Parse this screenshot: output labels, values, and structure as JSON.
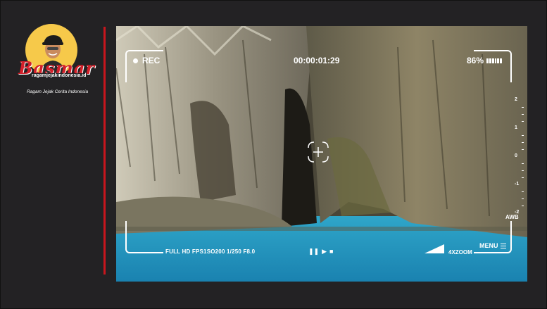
{
  "brand": {
    "logo_script": "Basmar",
    "site": "ragamjejakindonesia.id",
    "tagline": "Ragam Jejak Cerita Indonesia"
  },
  "viewfinder": {
    "rec_label": "REC",
    "timecode": "00:00:01:29",
    "battery_percent": "86%",
    "battery_level": 0.86,
    "exposure_scale": [
      "2",
      "1",
      "0",
      "-1",
      "-2"
    ],
    "awb_label": "AWB",
    "info_line": "FULL HD FPS1SO200 1/250 F8.0",
    "controls": [
      "pause-icon",
      "play-icon",
      "stop-icon"
    ],
    "zoom_label": "4XZOOM",
    "menu_label": "MENU"
  },
  "colors": {
    "background": "#232224",
    "accent_red": "#c8161d",
    "logo_yellow": "#f6c94a",
    "hud": "#ffffff"
  }
}
